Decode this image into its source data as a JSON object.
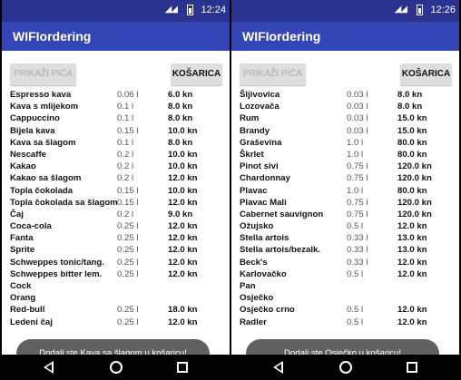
{
  "screens": [
    {
      "status_time": "12:24",
      "app_title": "WIFIordering",
      "drinks_button": "PRIKAŽI PIĆA",
      "cart_button": "KOŠARICA",
      "toast": "Dodali ste Kava sa šlagom u košaricu!",
      "rows": [
        {
          "name": "Espresso kava",
          "vol": "0.06 l",
          "price": "6.0 kn"
        },
        {
          "name": "Kava s mlijekom",
          "vol": "0.1 l",
          "price": "8.0 kn"
        },
        {
          "name": "Cappuccino",
          "vol": "0.1 l",
          "price": "8.0 kn"
        },
        {
          "name": "Bijela kava",
          "vol": "0.15 l",
          "price": "10.0 kn"
        },
        {
          "name": "Kava sa šlagom",
          "vol": "0.1 l",
          "price": "8.0 kn"
        },
        {
          "name": "Nescaffe",
          "vol": "0.2 l",
          "price": "10.0 kn"
        },
        {
          "name": "Kakao",
          "vol": "0.2 l",
          "price": "10.0 kn"
        },
        {
          "name": "Kakao sa šlagom",
          "vol": "0.2 l",
          "price": "12.0 kn"
        },
        {
          "name": "Topla čokolada",
          "vol": "0.15 l",
          "price": "10.0 kn"
        },
        {
          "name": "Topla čokolada sa šlagom",
          "vol": "0.15 l",
          "price": "12.0 kn"
        },
        {
          "name": "Čaj",
          "vol": "0.2 l",
          "price": "9.0 kn"
        },
        {
          "name": "Coca-cola",
          "vol": "0.25 l",
          "price": "12.0 kn"
        },
        {
          "name": "Fanta",
          "vol": "0.25 l",
          "price": "12.0 kn"
        },
        {
          "name": "Sprite",
          "vol": "0.25 l",
          "price": "12.0 kn"
        },
        {
          "name": "Schweppes tonic/tang.",
          "vol": "0.25 l",
          "price": "12.0 kn"
        },
        {
          "name": "Schweppes bitter lem.",
          "vol": "0.25 l",
          "price": "12.0 kn"
        },
        {
          "name": "Cock",
          "vol": "",
          "price": ""
        },
        {
          "name": "Orang",
          "vol": "",
          "price": ""
        },
        {
          "name": "Red-bull",
          "vol": "0.25 l",
          "price": "18.0 kn"
        },
        {
          "name": "Ledeni čaj",
          "vol": "0.25 l",
          "price": "12.0 kn"
        }
      ]
    },
    {
      "status_time": "12:26",
      "app_title": "WIFIordering",
      "drinks_button": "PRIKAŽI PIĆA",
      "cart_button": "KOŠARICA",
      "toast": "Dodali ste Osječko u košaricu!",
      "rows": [
        {
          "name": "Šljivovica",
          "vol": "0.03 l",
          "price": "8.0 kn"
        },
        {
          "name": "Lozovača",
          "vol": "0.03 l",
          "price": "8.0 kn"
        },
        {
          "name": "Rum",
          "vol": "0.03 l",
          "price": "15.0 kn"
        },
        {
          "name": "Brandy",
          "vol": "0.03 l",
          "price": "15.0 kn"
        },
        {
          "name": "Graševina",
          "vol": "1.0 l",
          "price": "80.0 kn"
        },
        {
          "name": "Škrlet",
          "vol": "1.0 l",
          "price": "80.0 kn"
        },
        {
          "name": "Pinot sivi",
          "vol": "0.75 l",
          "price": "120.0 kn"
        },
        {
          "name": "Chardonnay",
          "vol": "0.75 l",
          "price": "120.0 kn"
        },
        {
          "name": "Plavac",
          "vol": "1.0 l",
          "price": "80.0 kn"
        },
        {
          "name": "Plavac Mali",
          "vol": "0.75 l",
          "price": "120.0 kn"
        },
        {
          "name": "Cabernet sauvignon",
          "vol": "0.75 l",
          "price": "120.0 kn"
        },
        {
          "name": "Ožujsko",
          "vol": "0.5 l",
          "price": "12.0 kn"
        },
        {
          "name": "Stella artois",
          "vol": "0.33 l",
          "price": "13.0 kn"
        },
        {
          "name": "Stella artois/bezalk.",
          "vol": "0.33 l",
          "price": "13.0 kn"
        },
        {
          "name": "Beck's",
          "vol": "0.33 l",
          "price": "12.0 kn"
        },
        {
          "name": "Karlovačko",
          "vol": "0.5 l",
          "price": "12.0 kn"
        },
        {
          "name": "Pan",
          "vol": "",
          "price": ""
        },
        {
          "name": "Osječko",
          "vol": "",
          "price": ""
        },
        {
          "name": "Osječko crno",
          "vol": "0.5 l",
          "price": "12.0 kn"
        },
        {
          "name": "Radler",
          "vol": "0.5 l",
          "price": "12.0 kn"
        }
      ]
    }
  ]
}
